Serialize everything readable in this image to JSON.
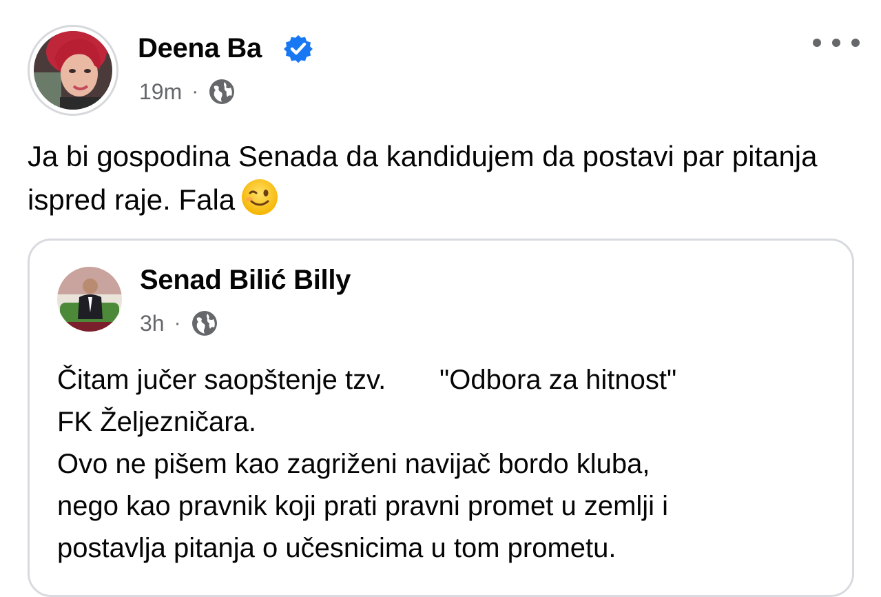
{
  "post": {
    "author": "Deena Ba",
    "verified_icon": "verified-badge-icon",
    "time": "19m",
    "separator": "·",
    "privacy_icon": "globe-icon",
    "text": "Ja bi gospodina Senada da kandidujem da postavi par pitanja ispred raje. Fala",
    "emoji": "winking-face-emoji",
    "more_icon": "more-options-icon"
  },
  "shared": {
    "author": "Senad Bilić Billy",
    "time": "3h",
    "separator": "·",
    "privacy_icon": "globe-icon",
    "text_lines": [
      "Čitam jučer saopštenje tzv.       \"Odbora za hitnost\"",
      "FK Željezničara.",
      "Ovo ne pišem kao zagriženi navijač bordo kluba,",
      "nego kao pravnik koji prati pravni promet u zemlji i",
      "postavlja pitanja o učesnicima u tom prometu."
    ]
  },
  "colors": {
    "text": "#050505",
    "secondary": "#65676b",
    "verified": "#1877f2",
    "card_border": "#d8dadf"
  }
}
